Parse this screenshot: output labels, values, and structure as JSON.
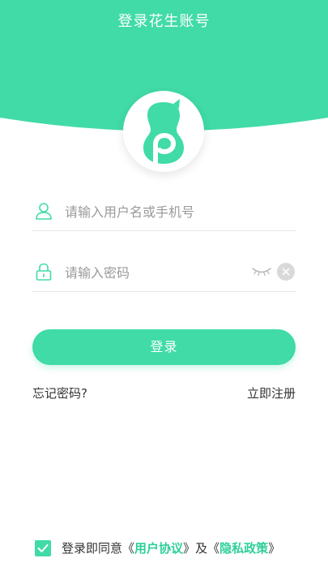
{
  "header": {
    "title": "登录花生账号",
    "brand_color": "#40dba6"
  },
  "logo": {
    "icon": "peanut-logo-icon"
  },
  "username_field": {
    "icon": "user-icon",
    "placeholder": "请输入用户名或手机号",
    "value": ""
  },
  "password_field": {
    "icon": "lock-icon",
    "placeholder": "请输入密码",
    "value": "",
    "toggle_icon": "eye-closed-icon",
    "clear_icon": "clear-icon"
  },
  "login_button": {
    "label": "登录"
  },
  "links": {
    "forgot": "忘记密码?",
    "register": "立即注册"
  },
  "agreement": {
    "checked": true,
    "prefix": "登录即同意",
    "open_bracket_1": "《",
    "user_agreement": "用户协议",
    "close_bracket_1": "》",
    "conjunction": "及",
    "open_bracket_2": "《",
    "privacy_policy": "隐私政策",
    "close_bracket_2": "》"
  }
}
